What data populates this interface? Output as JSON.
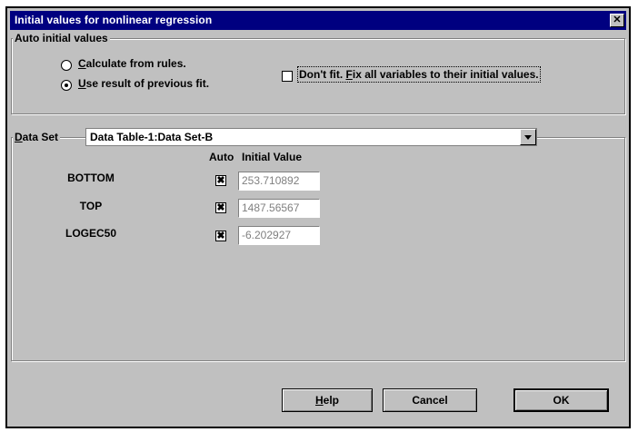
{
  "dialog": {
    "title": "Initial values for nonlinear regression",
    "close_glyph": "✕"
  },
  "auto_group": {
    "label": "Auto initial values",
    "options": [
      {
        "prefix": "",
        "mnemonic": "C",
        "suffix": "alculate from rules.",
        "selected": false
      },
      {
        "prefix": "",
        "mnemonic": "U",
        "suffix": "se result of previous fit.",
        "selected": true
      }
    ],
    "dont_fit": {
      "prefix": "Don't fit. ",
      "mnemonic": "F",
      "suffix": "ix all variables to their initial values.",
      "checked": false
    }
  },
  "dataset": {
    "label_mnemonic": "D",
    "label_rest": "ata Set",
    "value": "Data Table-1:Data Set-B"
  },
  "table": {
    "headers": {
      "auto": "Auto",
      "initial": "Initial Value"
    },
    "rows": [
      {
        "name": "BOTTOM",
        "auto": "✖",
        "value": "253.710892"
      },
      {
        "name": "TOP",
        "auto": "✖",
        "value": "1487.56567"
      },
      {
        "name": "LOGEC50",
        "auto": "✖",
        "value": "-6.202927"
      }
    ]
  },
  "buttons": {
    "help": {
      "mnemonic": "H",
      "rest": "elp"
    },
    "cancel": "Cancel",
    "ok": "OK"
  }
}
